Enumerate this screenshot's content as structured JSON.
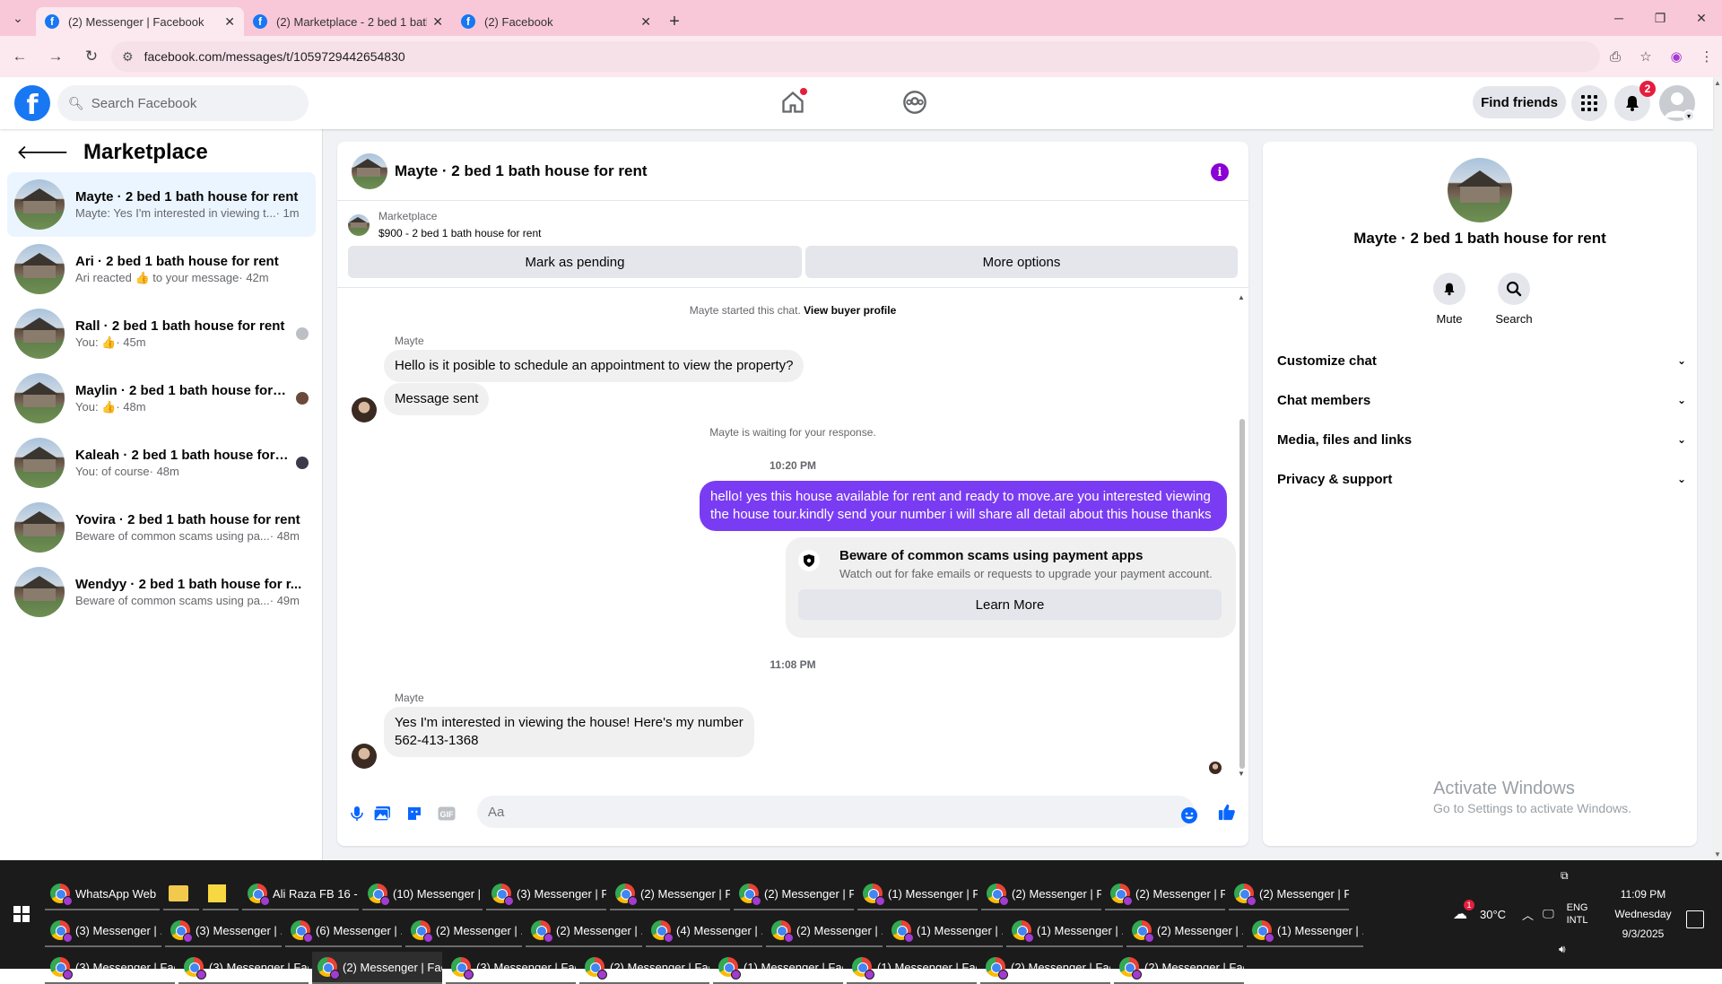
{
  "browser": {
    "tabs": [
      {
        "title": "(2) Messenger | Facebook",
        "active": true
      },
      {
        "title": "(2) Marketplace - 2 bed 1 bath",
        "active": false
      },
      {
        "title": "(2) Facebook",
        "active": false
      }
    ],
    "url": "facebook.com/messages/t/1059729442654830"
  },
  "fb": {
    "search_placeholder": "Search Facebook",
    "find_friends": "Find friends",
    "notif_count": "2"
  },
  "left": {
    "title": "Marketplace",
    "chats": [
      {
        "title": "Mayte · 2 bed 1 bath house for rent",
        "snippet": "Mayte: Yes I'm interested in viewing t...",
        "time": " · 1m",
        "active": true,
        "seen": ""
      },
      {
        "title": "Ari · 2 bed 1 bath house for rent",
        "snippet": "Ari reacted 👍 to your message",
        "time": " · 42m",
        "active": false,
        "seen": ""
      },
      {
        "title": "Rall · 2 bed 1 bath house for rent",
        "snippet": "You: 👍",
        "time": " · 45m",
        "active": false,
        "seen": "grey"
      },
      {
        "title": "Maylin · 2 bed 1 bath house for r...",
        "snippet": "You: 👍",
        "time": " · 48m",
        "active": false,
        "seen": "brown"
      },
      {
        "title": "Kaleah · 2 bed 1 bath house for r...",
        "snippet": "You: of course",
        "time": " · 48m",
        "active": false,
        "seen": "dark"
      },
      {
        "title": "Yovira · 2 bed 1 bath house for rent",
        "snippet": "Beware of common scams using pa...",
        "time": " · 48m",
        "active": false,
        "seen": ""
      },
      {
        "title": "Wendyy · 2 bed 1 bath house for r...",
        "snippet": "Beware of common scams using pa...",
        "time": " · 49m",
        "active": false,
        "seen": ""
      }
    ]
  },
  "chat": {
    "title": "Mayte · 2 bed 1 bath house for rent",
    "marketplace_label": "Marketplace",
    "listing": "$900 - 2 bed 1 bath house for rent",
    "mark_pending": "Mark as pending",
    "more_options": "More options",
    "started_text": "Mayte started this chat. ",
    "view_profile": "View buyer profile",
    "sender1": "Mayte",
    "msg1": "Hello is it posible to schedule an appointment to view the property?",
    "msg2": "Message sent",
    "waiting": "Mayte is waiting for your response.",
    "time1": "10:20 PM",
    "mine1": "hello! yes this house available for rent and ready to move.are you interested viewing the house tour.kindly send your number i will share all detail about this house thanks",
    "scam_title": "Beware of common scams using payment apps",
    "scam_sub": "Watch out for fake emails or requests to upgrade your payment account.",
    "learn_more": "Learn More",
    "time2": "11:08 PM",
    "sender2": "Mayte",
    "msg3_line1": "Yes I'm interested in viewing the house! Here's my number",
    "msg3_line2": "562-413-1368",
    "input_placeholder": "Aa"
  },
  "right": {
    "title": "Mayte · 2 bed 1 bath house for rent",
    "mute": "Mute",
    "search": "Search",
    "sections": [
      "Customize chat",
      "Chat members",
      "Media, files and links",
      "Privacy & support"
    ]
  },
  "watermark": {
    "line1": "Activate Windows",
    "line2": "Go to Settings to activate Windows."
  },
  "taskbar": {
    "row1": [
      "WhatsApp Web",
      "",
      "",
      "Ali Raza FB 16 - ...",
      "(10) Messenger | ...",
      "(3) Messenger | F...",
      "(2) Messenger | F...",
      "(2) Messenger | F...",
      "(1) Messenger | F...",
      "(2) Messenger | F...",
      "(2) Messenger | F...",
      "(2) Messenger | F..."
    ],
    "row2": [
      "(3) Messenger | ...",
      "(3) Messenger | ...",
      "(6) Messenger | ...",
      "(2) Messenger | ...",
      "(2) Messenger | ...",
      "(4) Messenger | ...",
      "(2) Messenger | ...",
      "(1) Messenger | ...",
      "(1) Messenger | ...",
      "(2) Messenger | ...",
      "(1) Messenger | ..."
    ],
    "row3": [
      "(3) Messenger | Fac...",
      "(3) Messenger | Fac...",
      "(2) Messenger | Fac...",
      "(3) Messenger | Fac...",
      "(2) Messenger | Fac...",
      "(1) Messenger | Fac...",
      "(1) Messenger | Fac...",
      "(2) Messenger | Fac...",
      "(2) Messenger | Fac..."
    ],
    "weather_badge": "1",
    "temperature": "30°C",
    "lang1": "ENG",
    "lang2": "INTL",
    "time": "11:09 PM",
    "day": "Wednesday",
    "date": "9/3/2025"
  }
}
